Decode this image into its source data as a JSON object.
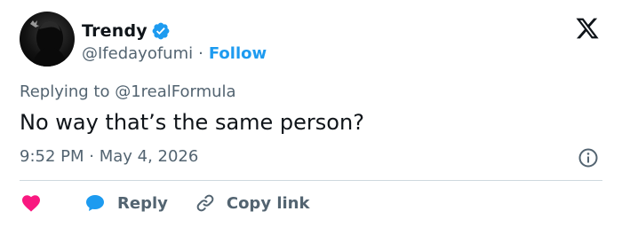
{
  "tweet": {
    "author": {
      "display_name": "Trendy",
      "handle": "@Ifedayofumi",
      "verified": true,
      "avatar_icon": "profile-avatar-silhouette"
    },
    "separator": "·",
    "follow_label": "Follow",
    "replying_to": "Replying to @1realFormula",
    "text": "No way that’s the same person?",
    "timestamp": "9:52 PM · May 4, 2026"
  },
  "actions": {
    "like_icon": "heart-icon",
    "reply_label": "Reply",
    "copy_link_label": "Copy link"
  },
  "colors": {
    "accent": "#1d9bf0",
    "like": "#f91880",
    "muted": "#536471",
    "text": "#0f1419",
    "divider": "#cfd9de"
  }
}
